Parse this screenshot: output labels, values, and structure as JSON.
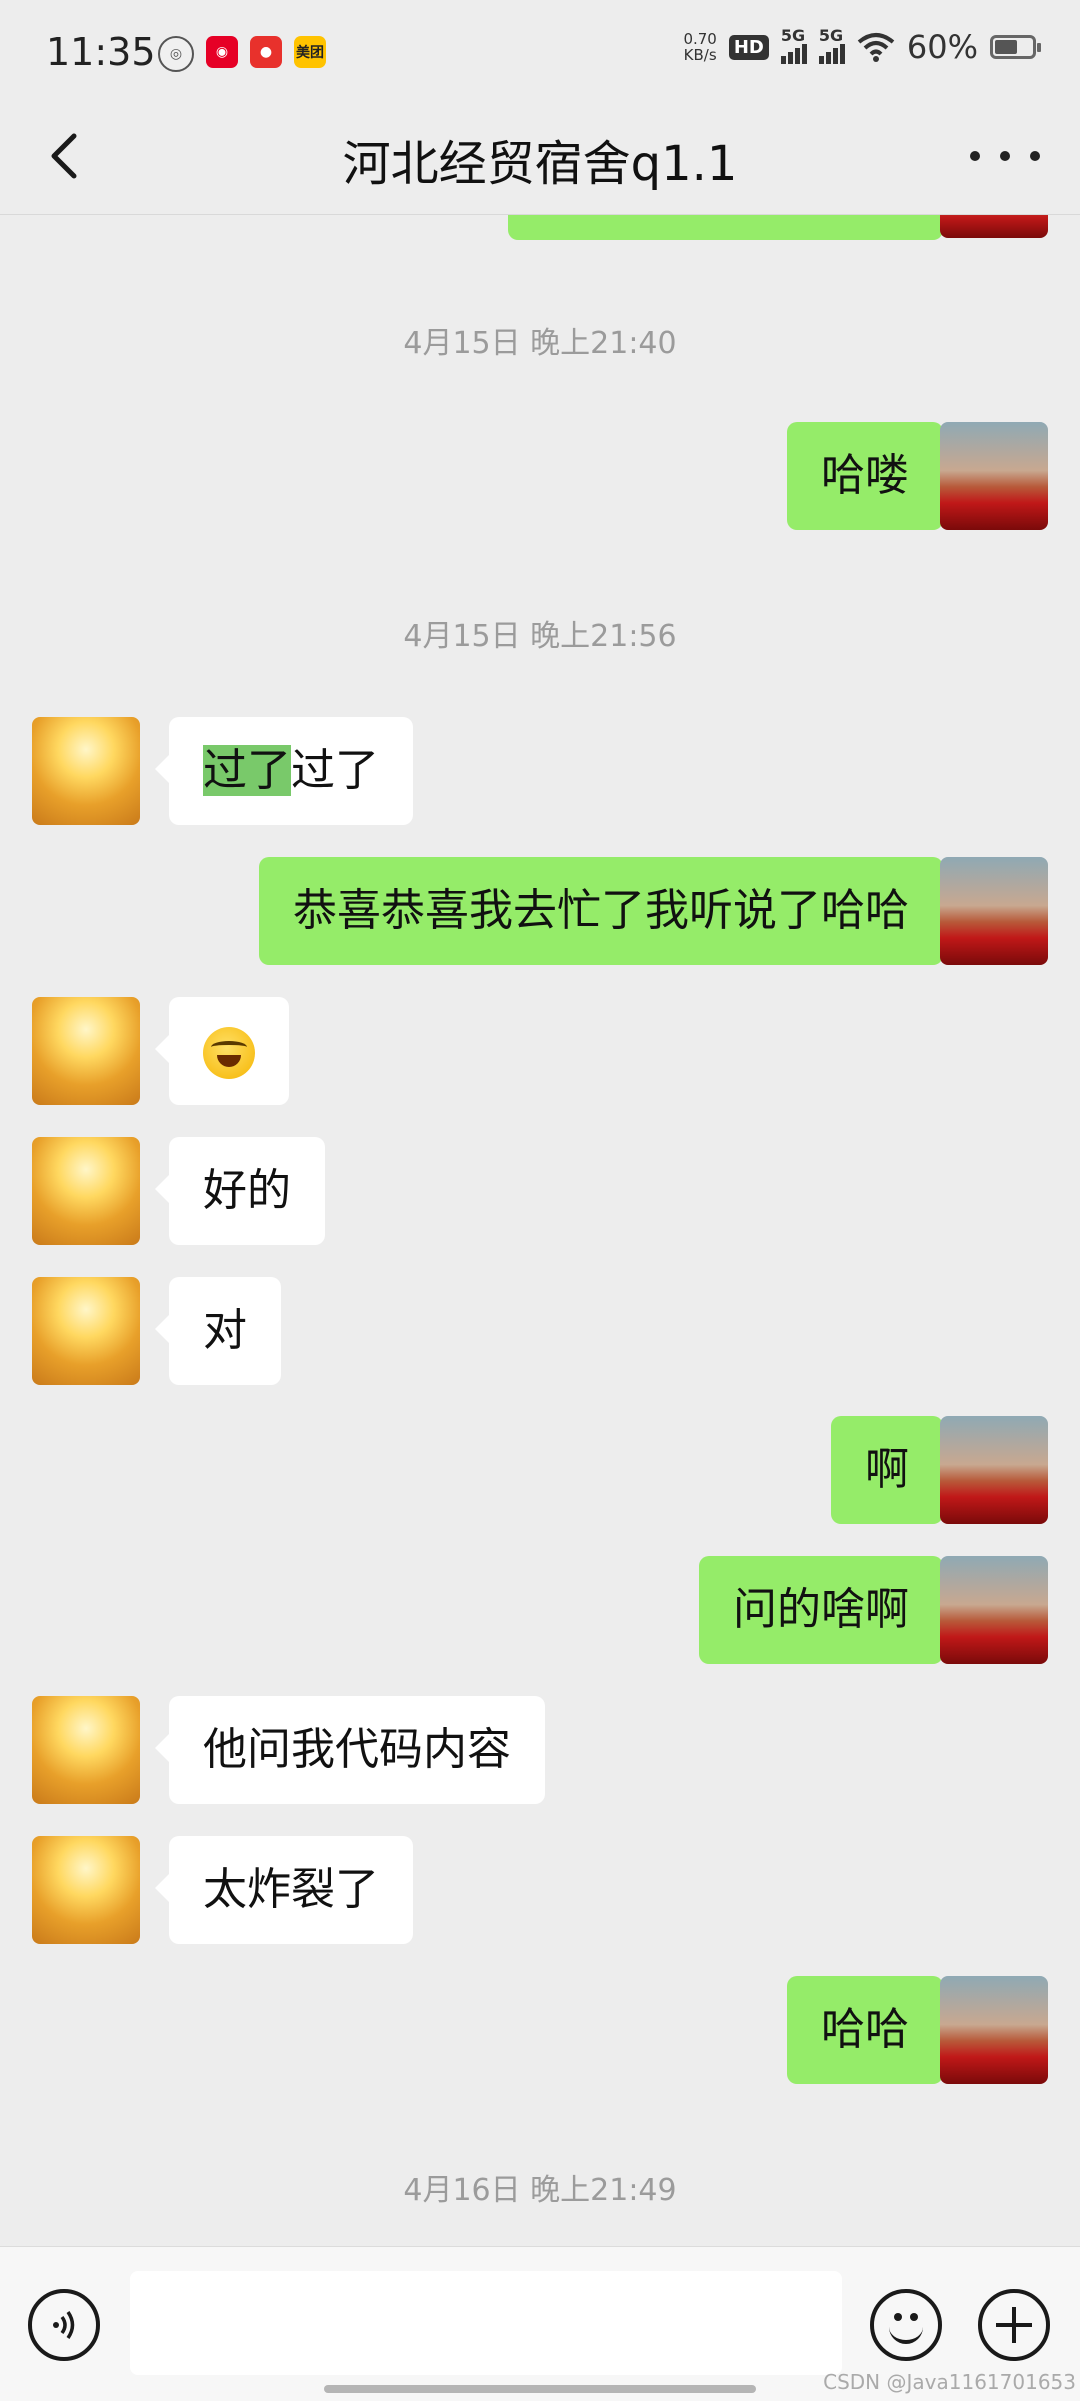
{
  "status_bar": {
    "time": "11:35",
    "network_speed": "0.70",
    "network_speed_unit": "KB/s",
    "hd_label": "HD",
    "sim1_label": "5G",
    "sim2_label": "5G",
    "battery": "60%",
    "apps": [
      {
        "icon": "orbit-app-icon",
        "color": "#555555"
      },
      {
        "icon": "netease-music-icon",
        "color": "#e60026"
      },
      {
        "icon": "dog-app-icon",
        "color": "#e8312c"
      },
      {
        "icon": "meituan-icon",
        "color": "#ffc300",
        "label": "美团"
      }
    ]
  },
  "header": {
    "title": "河北经贸宿舍q1.1"
  },
  "messages": [
    {
      "type": "time",
      "text": "4月15日 晚上21:40"
    },
    {
      "type": "msg",
      "side": "right",
      "text": "哈喽"
    },
    {
      "type": "time",
      "text": "4月15日 晚上21:56"
    },
    {
      "type": "msg",
      "side": "left",
      "highlight": "过了",
      "text": "过了"
    },
    {
      "type": "msg",
      "side": "right",
      "text": "恭喜恭喜我去忙了我听说了哈哈"
    },
    {
      "type": "msg",
      "side": "left",
      "emoji": "face-with-tears-of-joy",
      "text": ""
    },
    {
      "type": "msg",
      "side": "left",
      "text": "好的"
    },
    {
      "type": "msg",
      "side": "left",
      "text": "对"
    },
    {
      "type": "msg",
      "side": "right",
      "text": "啊"
    },
    {
      "type": "msg",
      "side": "right",
      "text": "问的啥啊"
    },
    {
      "type": "msg",
      "side": "left",
      "text": "他问我代码内容"
    },
    {
      "type": "msg",
      "side": "left",
      "text": "太炸裂了"
    },
    {
      "type": "msg",
      "side": "right",
      "text": "哈哈"
    },
    {
      "type": "time",
      "text": "4月16日 晚上21:49"
    }
  ],
  "input_bar": {
    "value": "",
    "voice_icon": "voice-icon",
    "emoji_icon": "emoji-icon",
    "plus_icon": "plus-icon"
  },
  "colors": {
    "background": "#ededed",
    "my_bubble": "#95ec69",
    "their_bubble": "#ffffff"
  },
  "watermark": "CSDN @Java1161701653"
}
